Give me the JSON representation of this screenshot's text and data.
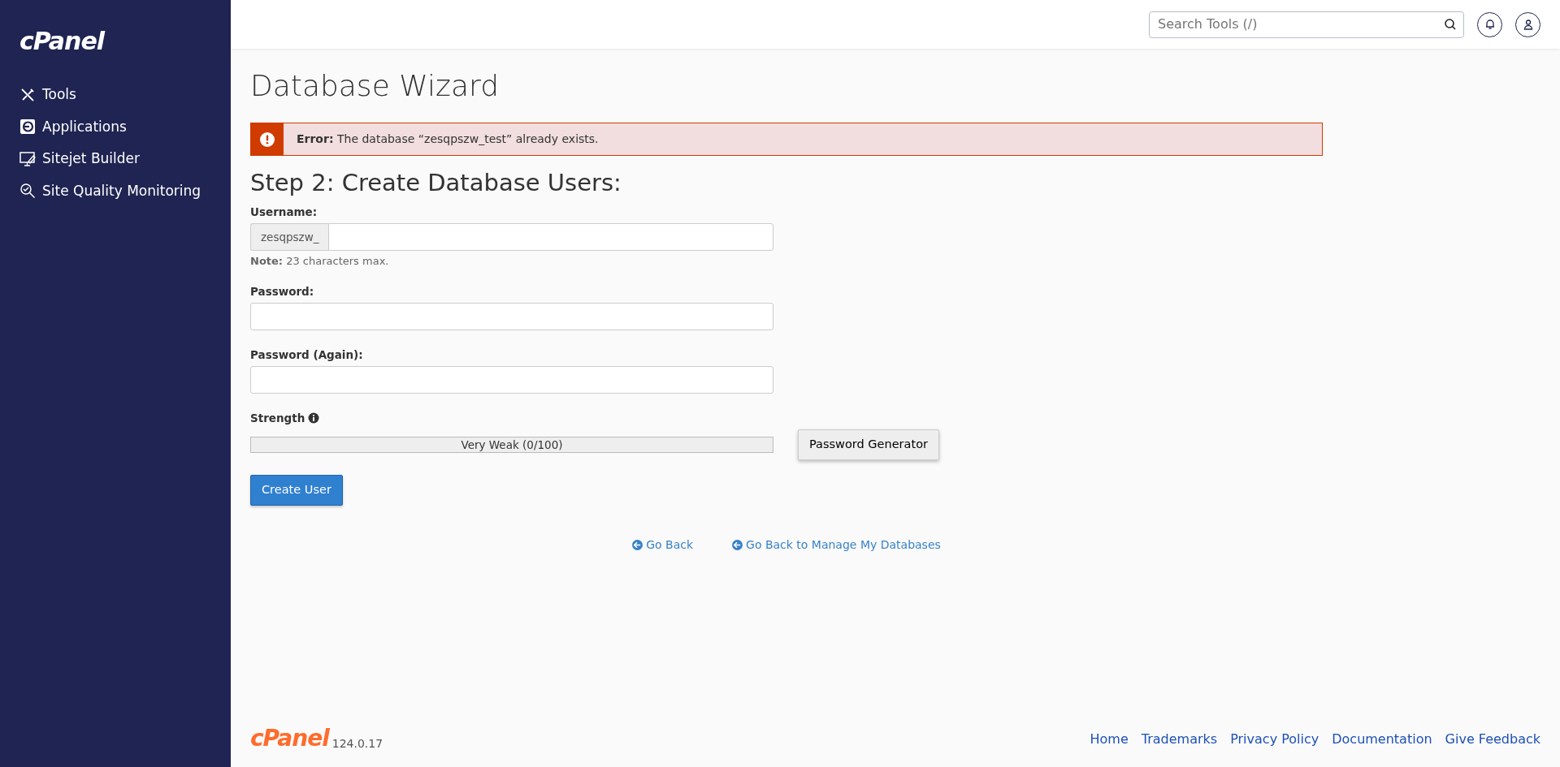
{
  "sidebar": {
    "logo": "cPanel",
    "items": [
      {
        "label": "Tools"
      },
      {
        "label": "Applications"
      },
      {
        "label": "Sitejet Builder"
      },
      {
        "label": "Site Quality Monitoring"
      }
    ]
  },
  "topbar": {
    "search": {
      "placeholder": "Search Tools (/)"
    }
  },
  "page": {
    "title": "Database Wizard",
    "alert": {
      "label": "Error:",
      "message": "The database “zesqpszw_test” already exists."
    },
    "heading": "Step 2: Create Database Users:",
    "form": {
      "username": {
        "label": "Username:",
        "prefix": "zesqpszw_",
        "note_label": "Note:",
        "note": "23 characters max."
      },
      "password": {
        "label": "Password:"
      },
      "password_again": {
        "label": "Password (Again):"
      },
      "strength": {
        "label": "Strength",
        "level": 0,
        "reading": "Very Weak (0/100)"
      },
      "generator_button": "Password Generator",
      "submit_button": "Create User"
    },
    "links": [
      "Go Back",
      "Go Back to Manage My Databases"
    ]
  },
  "footer": {
    "logo": "cPanel",
    "version": "124.0.17",
    "links": [
      "Home",
      "Trademarks",
      "Privacy Policy",
      "Documentation",
      "Give Feedback"
    ]
  }
}
